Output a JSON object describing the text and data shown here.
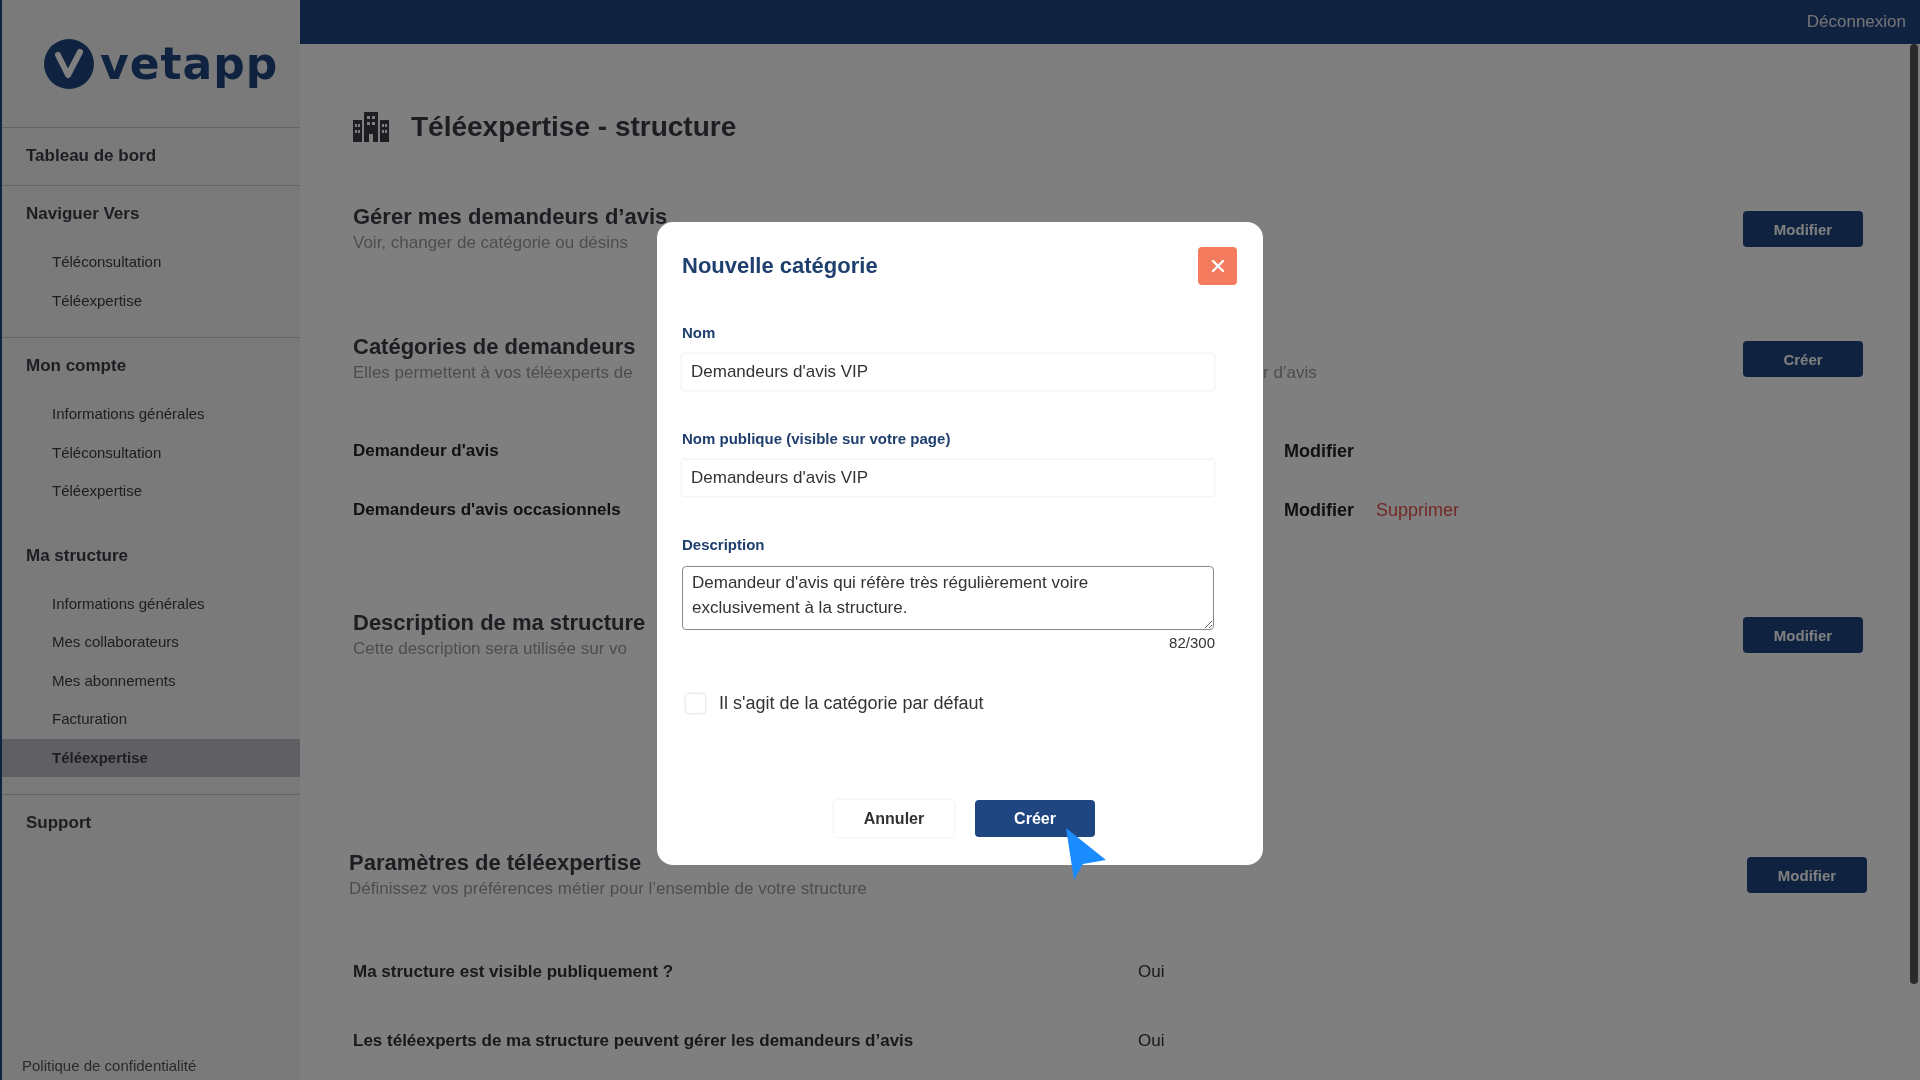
{
  "sidebar": {
    "logo": "vetapp",
    "groups": [
      {
        "title": "Tableau de bord"
      },
      {
        "title": "Naviguer Vers",
        "items": [
          {
            "label": "Téléconsultation",
            "selected": false
          },
          {
            "label": "Téléexpertise",
            "selected": false
          }
        ]
      },
      {
        "title": "Mon compte",
        "items": [
          {
            "label": "Informations générales",
            "selected": false
          },
          {
            "label": "Téléconsultation",
            "selected": false
          },
          {
            "label": "Téléexpertise",
            "selected": false
          }
        ]
      },
      {
        "title": "Ma structure",
        "items": [
          {
            "label": "Informations générales",
            "selected": false
          },
          {
            "label": "Mes collaborateurs",
            "selected": false
          },
          {
            "label": "Mes abonnements",
            "selected": false
          },
          {
            "label": "Facturation",
            "selected": false
          },
          {
            "label": "Téléexpertise",
            "selected": true
          }
        ]
      },
      {
        "title": "Support"
      }
    ],
    "footer_link": "Politique de confidentialité"
  },
  "top_bar": {
    "logout": "Déconnexion"
  },
  "page": {
    "title": "Téléexpertise - structure",
    "sections": [
      {
        "heading": "Gérer mes demandeurs d’avis",
        "subtitle": "Voir, changer de catégorie ou désins",
        "button": "Modifier"
      },
      {
        "heading": "Catégories de demandeurs",
        "subtitle": "Elles permettent à vos téléexperts de",
        "subtitle_tail": "r d’avis",
        "button": "Créer",
        "rows": [
          {
            "name": "Demandeur d'avis",
            "actions": [
              {
                "label": "Modifier",
                "kind": "edit"
              }
            ]
          },
          {
            "name": "Demandeurs d'avis occasionnels",
            "actions": [
              {
                "label": "Modifier",
                "kind": "edit"
              },
              {
                "label": "Supprimer",
                "kind": "delete"
              }
            ]
          }
        ]
      },
      {
        "heading": "Description de ma structure",
        "subtitle": "Cette description sera utilisée sur vo",
        "button": "Modifier"
      },
      {
        "heading": "Paramètres de téléexpertise",
        "subtitle": "Définissez vos préférences métier pour l’ensemble de votre structure",
        "button": "Modifier",
        "settings": [
          {
            "question": "Ma structure est visible publiquement ?",
            "answer": "Oui"
          },
          {
            "question": "Les téléexperts de ma structure peuvent gérer les demandeurs d’avis",
            "answer": "Oui"
          }
        ]
      }
    ]
  },
  "modal": {
    "title": "Nouvelle catégorie",
    "fields": [
      {
        "kind": "input",
        "label": "Nom",
        "value": "Demandeurs d'avis VIP"
      },
      {
        "kind": "input",
        "label": "Nom publique (visible sur votre page)",
        "value": "Demandeurs d'avis VIP"
      },
      {
        "kind": "textarea",
        "label": "Description",
        "value": "Demandeur d'avis qui réfère très régulièrement voire exclusivement à la structure.",
        "counter": "82/300"
      }
    ],
    "checkbox": {
      "label": "Il s'agit de la catégorie par défaut",
      "checked": false
    },
    "buttons": [
      {
        "label": "Annuler",
        "kind": "secondary"
      },
      {
        "label": "Créer",
        "kind": "primary"
      }
    ]
  }
}
